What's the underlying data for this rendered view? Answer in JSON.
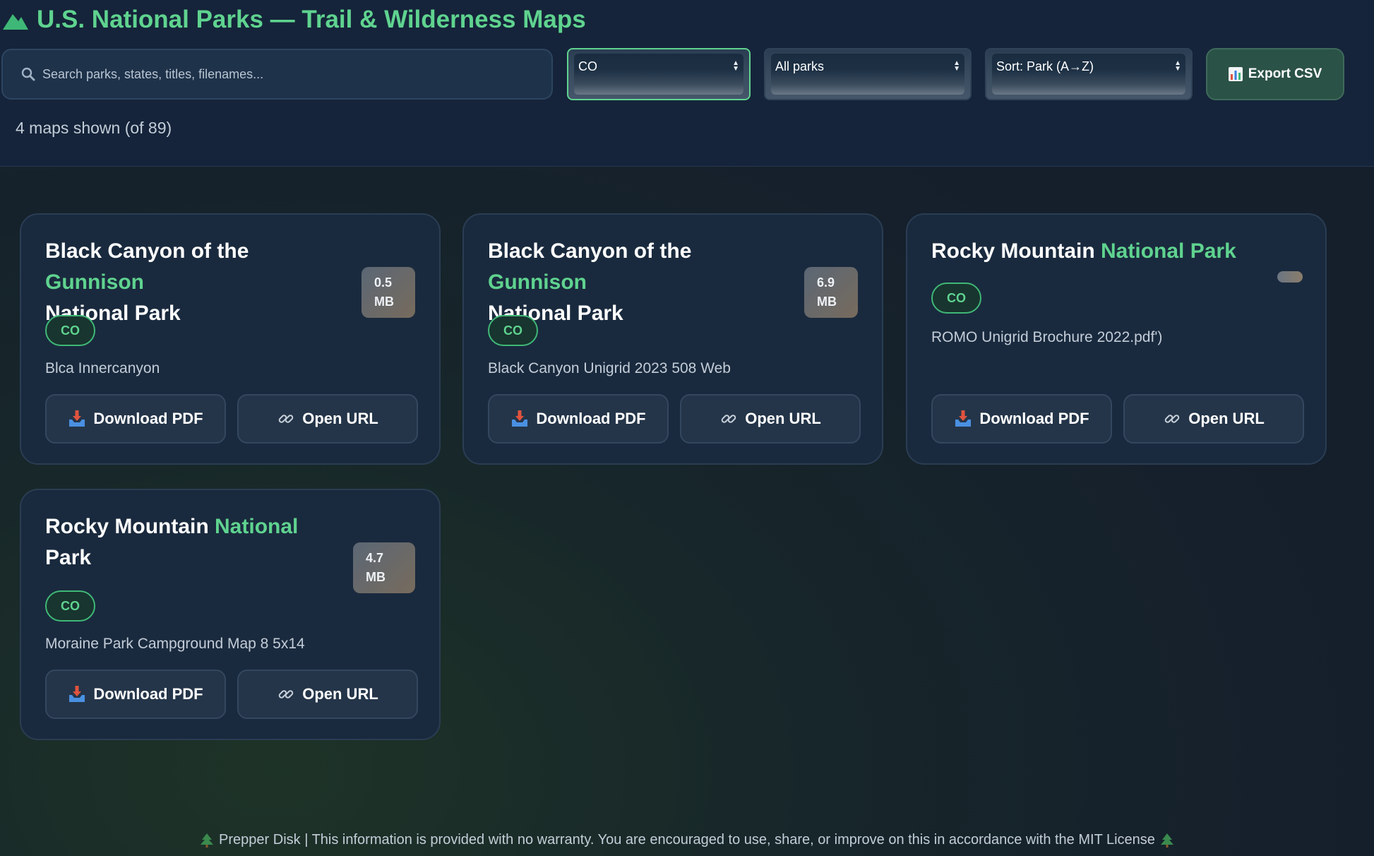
{
  "header": {
    "title": "U.S. National Parks — Trail & Wilderness Maps",
    "search_placeholder": "Search parks, states, titles, filenames...",
    "state_select": "CO",
    "park_select": "All parks",
    "sort_select": "Sort: Park (A→Z)",
    "export_label": "Export CSV",
    "count_text": "4 maps shown (of 89)"
  },
  "cards": [
    {
      "title_main": "Black Canyon of the ",
      "title_hl": "Gunnison",
      "title_rest": "National Park",
      "size_value": "0.5",
      "size_unit": "MB",
      "state": "CO",
      "filename": "Blca Innercanyon",
      "download_label": "Download PDF",
      "open_label": "Open URL"
    },
    {
      "title_main": "Black Canyon of the ",
      "title_hl": "Gunnison",
      "title_rest": "National Park",
      "size_value": "6.9",
      "size_unit": "MB",
      "state": "CO",
      "filename": "Black Canyon Unigrid 2023 508 Web",
      "download_label": "Download PDF",
      "open_label": "Open URL"
    },
    {
      "title_main": "Rocky Mountain ",
      "title_hl": "National Park",
      "title_rest": "",
      "state": "CO",
      "filename": "ROMO Unigrid Brochure 2022.pdf')",
      "download_label": "Download PDF",
      "open_label": "Open URL"
    },
    {
      "title_main": "Rocky Mountain ",
      "title_hl": "National",
      "title_rest": "Park",
      "size_value": "4.7",
      "size_unit": "MB",
      "state": "CO",
      "filename": "Moraine Park Campground Map 8 5x14",
      "download_label": "Download PDF",
      "open_label": "Open URL"
    }
  ],
  "footer": {
    "text": "Prepper Disk | This information is provided with no warranty. You are encouraged to use, share, or improve on this in accordance with the MIT License"
  },
  "colors": {
    "accent": "#5fd38f",
    "header_bg": "#15243a",
    "card_bg": "#1a2a3e",
    "button_bg": "#243549"
  },
  "icons": {
    "title": "mountain-icon",
    "search": "magnifier-icon",
    "export": "bar-chart-icon",
    "download": "inbox-tray-icon",
    "open": "link-icon",
    "footer": "evergreen-tree-icon"
  }
}
